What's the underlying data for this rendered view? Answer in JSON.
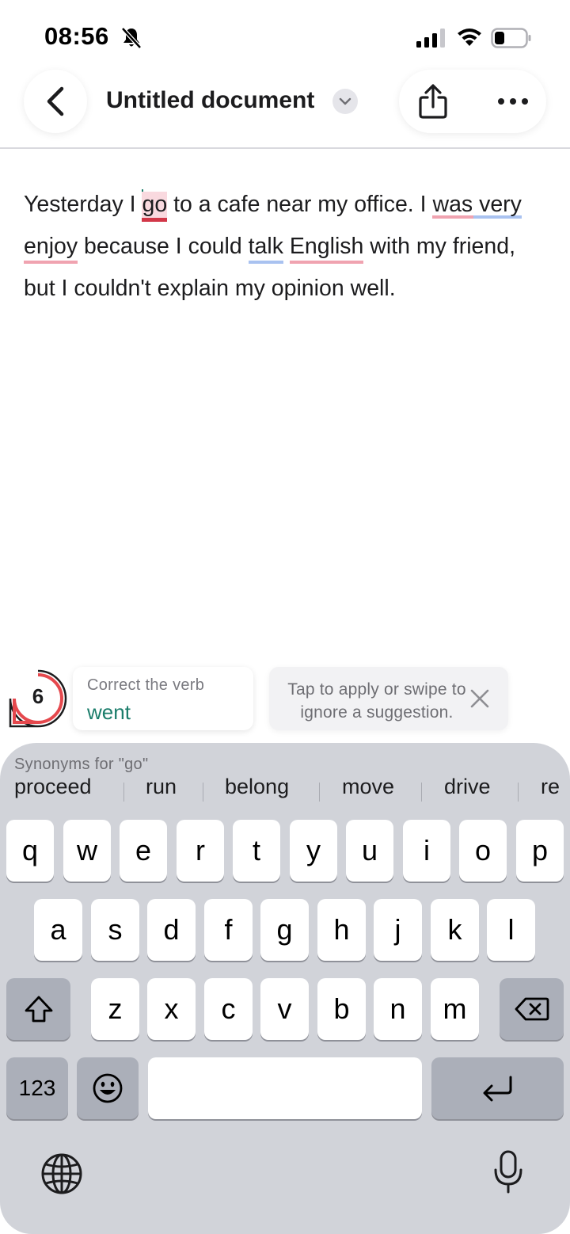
{
  "status_bar": {
    "time": "08:56",
    "icons": [
      "bell-slash-icon",
      "signal-icon",
      "wifi-icon",
      "battery-icon"
    ]
  },
  "nav": {
    "title": "Untitled document",
    "icons": [
      "back-chevron-icon",
      "chevron-down-icon",
      "share-icon",
      "more-icon"
    ]
  },
  "editor": {
    "segments": [
      "Yesterday I ",
      "go",
      " to a cafe near my office. I ",
      "was very",
      "enjoy",
      " because I could ",
      "talk",
      " ",
      "English",
      " with my friend,",
      "but I couldn't explain my opinion well."
    ],
    "colors": {
      "correctness_underline": "#f0a3b0",
      "clarity_underline": "#a9c2f0",
      "active_underline": "#d23748",
      "active_highlight": "#f9d9df"
    }
  },
  "assistant": {
    "score": "6",
    "suggestion_label": "Correct the verb",
    "suggestion_value": "went",
    "tip": "Tap to apply or swipe to ignore a suggestion.",
    "accent": "#1b7d6b",
    "score_ring_color": "#e5484d"
  },
  "keyboard": {
    "synonyms_label": "Synonyms for \"go\"",
    "synonyms": [
      "proceed",
      "run",
      "belong",
      "move",
      "drive",
      "re"
    ],
    "row1": [
      "q",
      "w",
      "e",
      "r",
      "t",
      "y",
      "u",
      "i",
      "o",
      "p"
    ],
    "row2": [
      "a",
      "s",
      "d",
      "f",
      "g",
      "h",
      "j",
      "k",
      "l"
    ],
    "row3": [
      "z",
      "x",
      "c",
      "v",
      "b",
      "n",
      "m"
    ],
    "numbers_label": "123",
    "icons": [
      "shift-icon",
      "delete-icon",
      "emoji-icon",
      "return-icon",
      "globe-icon",
      "microphone-icon"
    ]
  }
}
